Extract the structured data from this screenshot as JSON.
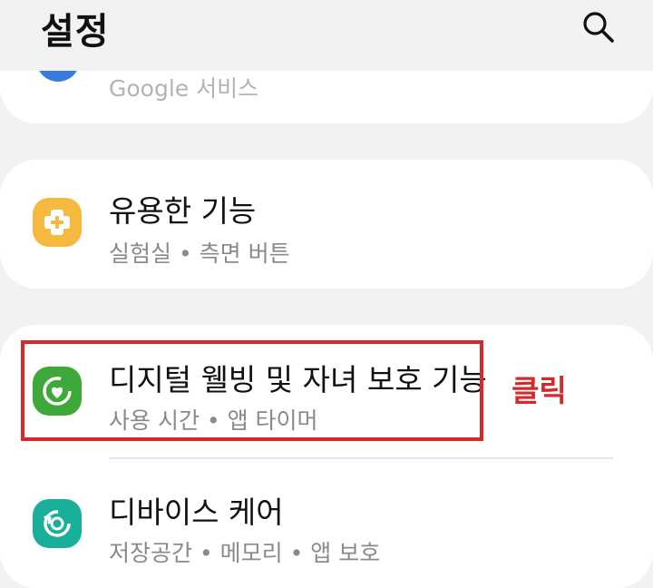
{
  "header": {
    "title": "설정",
    "search_icon": "search-icon"
  },
  "items": {
    "google": {
      "subtitle": "Google 서비스"
    },
    "useful": {
      "title": "유용한 기능",
      "subtitle": "실험실 • 측면 버튼",
      "icon": "puzzle-plus-icon",
      "icon_color": "#f6b93f"
    },
    "digital": {
      "title": "디지털 웰빙 및 자녀 보호 기능",
      "subtitle": "사용 시간 • 앱 타이머",
      "icon": "heart-circle-icon",
      "icon_color": "#3fa83a"
    },
    "device": {
      "title": "디바이스 케어",
      "subtitle": "저장공간 • 메모리 • 앱 보호",
      "icon": "device-care-icon",
      "icon_color": "#1aaf9a"
    }
  },
  "annotation": {
    "label": "클릭",
    "color": "#d42a2a"
  }
}
